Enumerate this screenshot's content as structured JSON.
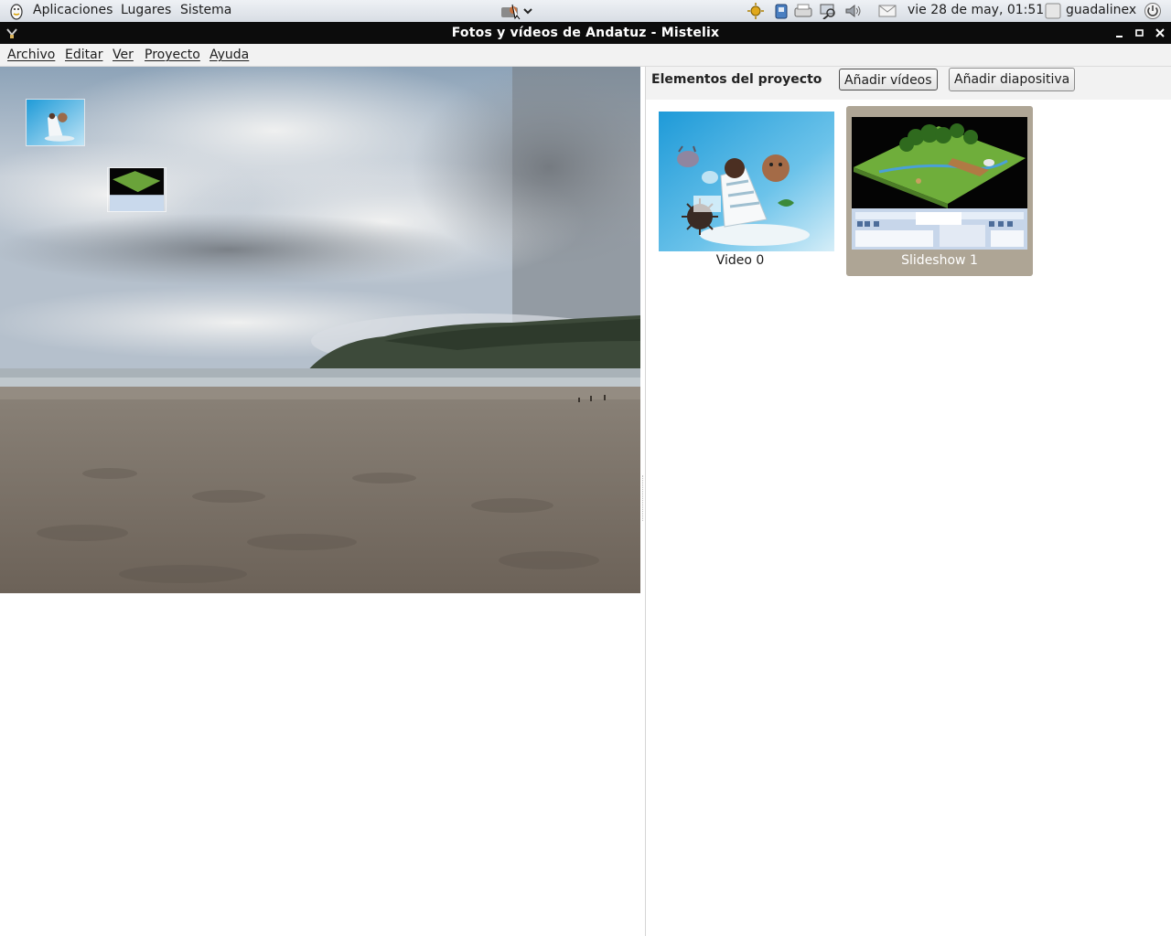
{
  "panel": {
    "menus": [
      "Aplicaciones",
      "Lugares",
      "Sistema"
    ],
    "clock": "vie 28 de may, 01:51",
    "user": "guadalinex",
    "icons": [
      "guadalinex-logo-icon",
      "app-launcher-icon",
      "dropdown-arrow-icon",
      "update-sun-icon",
      "usb-drive-icon",
      "printer-icon",
      "network-search-icon",
      "volume-icon",
      "mail-icon",
      "user-icon",
      "power-icon"
    ]
  },
  "window": {
    "title": "Fotos y vídeos de Andatuz - Mistelix",
    "controls": [
      "minimize-icon",
      "maximize-icon",
      "close-icon"
    ]
  },
  "menubar": {
    "items": [
      "Archivo",
      "Editar",
      "Ver",
      "Proyecto",
      "Ayuda"
    ]
  },
  "project": {
    "title": "Elementos del proyecto",
    "add_videos_label": "Añadir vídeos",
    "add_slideshow_label": "Añadir diapositiva",
    "elements": [
      {
        "label": "Video 0",
        "selected": false
      },
      {
        "label": "Slideshow 1",
        "selected": true
      }
    ]
  },
  "colors": {
    "selection_bg": "#aea595",
    "titlebar_bg": "#0c0c0c",
    "panel_bg": "#e3e7ec"
  }
}
